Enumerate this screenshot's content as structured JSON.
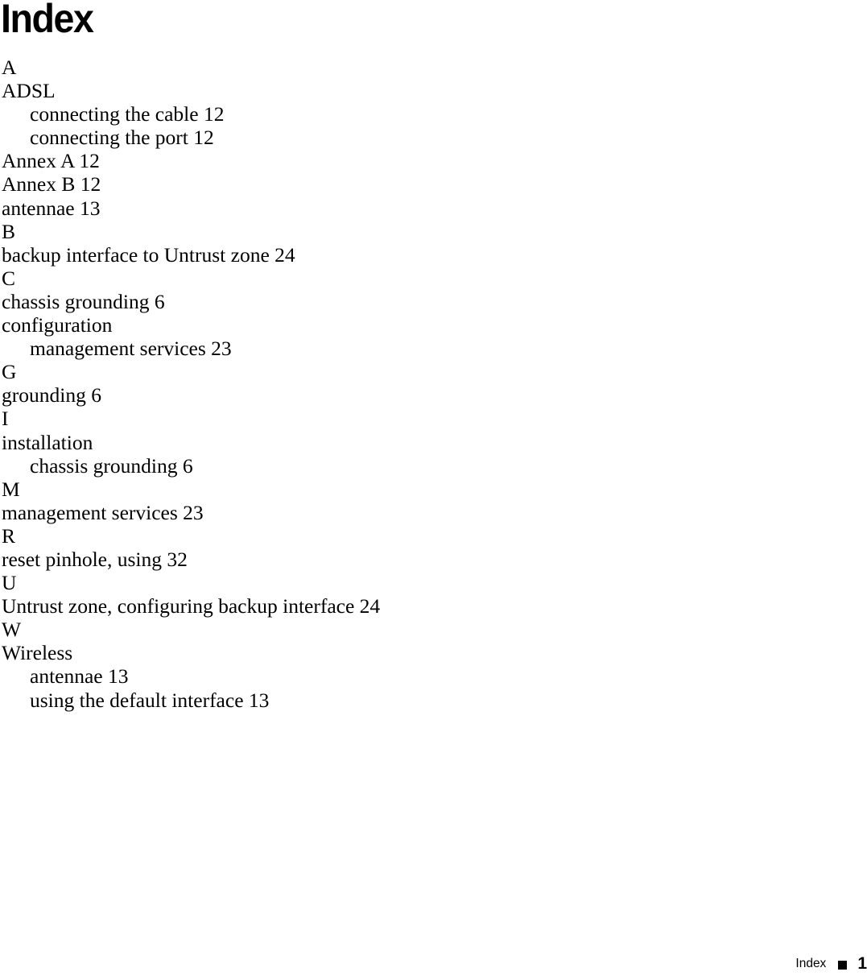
{
  "document": {
    "title": "Index"
  },
  "index": {
    "entries": [
      {
        "text": "A",
        "level": "letter"
      },
      {
        "text": "ADSL",
        "level": "main"
      },
      {
        "text": "connecting the cable 12",
        "level": "sub"
      },
      {
        "text": "connecting the port 12",
        "level": "sub"
      },
      {
        "text": "Annex A 12",
        "level": "main"
      },
      {
        "text": "Annex B 12",
        "level": "main"
      },
      {
        "text": "antennae 13",
        "level": "main"
      },
      {
        "text": "B",
        "level": "letter"
      },
      {
        "text": "backup interface to Untrust zone 24",
        "level": "main"
      },
      {
        "text": "C",
        "level": "letter"
      },
      {
        "text": "chassis grounding 6",
        "level": "main"
      },
      {
        "text": "configuration",
        "level": "main"
      },
      {
        "text": "management services 23",
        "level": "sub"
      },
      {
        "text": "G",
        "level": "letter"
      },
      {
        "text": "grounding 6",
        "level": "main"
      },
      {
        "text": "I",
        "level": "letter"
      },
      {
        "text": "installation",
        "level": "main"
      },
      {
        "text": "chassis grounding 6",
        "level": "sub"
      },
      {
        "text": "M",
        "level": "letter"
      },
      {
        "text": "management services 23",
        "level": "main"
      },
      {
        "text": "R",
        "level": "letter"
      },
      {
        "text": "reset pinhole, using 32",
        "level": "main"
      },
      {
        "text": "U",
        "level": "letter"
      },
      {
        "text": "Untrust zone, configuring backup interface 24",
        "level": "main"
      },
      {
        "text": "W",
        "level": "letter"
      },
      {
        "text": "Wireless",
        "level": "main"
      },
      {
        "text": "antennae 13",
        "level": "sub"
      },
      {
        "text": "using the default interface 13",
        "level": "sub"
      }
    ]
  },
  "footer": {
    "label": "Index",
    "bullet": "square-bullet-icon",
    "page_number": "1"
  },
  "colors": {
    "text": "#000000",
    "background": "#ffffff"
  }
}
